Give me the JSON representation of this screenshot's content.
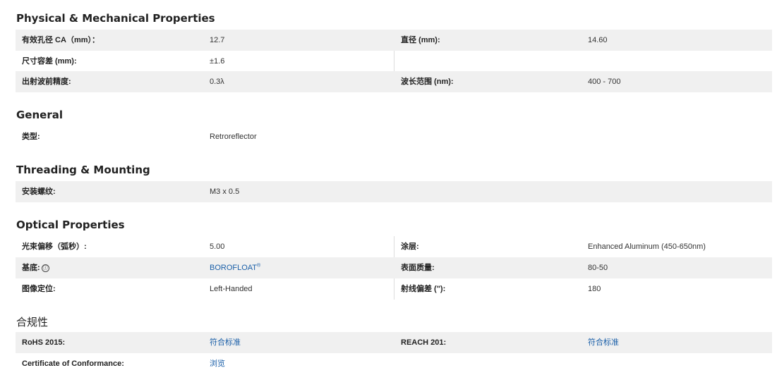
{
  "sections": {
    "physical": {
      "title": "Physical & Mechanical Properties",
      "rows": [
        {
          "label1": "有效孔径 CA（mm）：",
          "value1": "12.7",
          "label2": "直径 (mm):",
          "value2": "14.60"
        },
        {
          "label1": "尺寸容差 (mm):",
          "value1": "±1.6"
        },
        {
          "label1": "出射波前精度:",
          "value1": "0.3λ",
          "label2": "波长范围 (nm):",
          "value2": "400 - 700"
        }
      ]
    },
    "general": {
      "title": "General",
      "rows": [
        {
          "label1": "类型:",
          "value1": "Retroreflector"
        }
      ]
    },
    "threading": {
      "title": "Threading & Mounting",
      "rows": [
        {
          "label1": "安装螺纹:",
          "value1": "M3 x 0.5"
        }
      ]
    },
    "optical": {
      "title": "Optical Properties",
      "rows": [
        {
          "label1": "光束偏移（弧秒）:",
          "value1": "5.00",
          "label2": "涂层:",
          "value2": "Enhanced Aluminum (450-650nm)"
        },
        {
          "label1": "基底:",
          "value1": "BOROFLOAT",
          "value1_sup": "®",
          "label2": "表面质量:",
          "value2": "80-50"
        },
        {
          "label1": "图像定位:",
          "value1": "Left-Handed",
          "label2": "射线偏差 (\"):",
          "value2": "180"
        }
      ]
    },
    "compliance": {
      "title": "合规性",
      "rows": [
        {
          "label1": "RoHS 2015:",
          "value1": "符合标准",
          "label2": "REACH 201:",
          "value2": "符合标准"
        },
        {
          "label1": "Certificate of Conformance:",
          "value1": "浏览"
        }
      ]
    }
  },
  "icons": {
    "info": "ⓘ"
  },
  "colors": {
    "link": "#1a5fa8",
    "row_shade": "#f0f0f0",
    "divider": "#dddddd"
  }
}
